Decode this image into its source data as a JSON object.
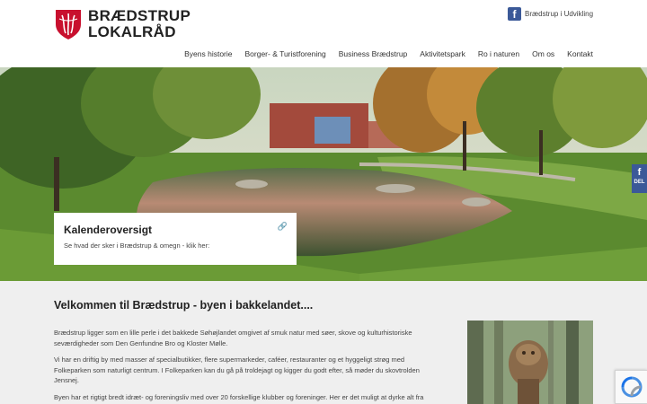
{
  "brand": {
    "line1": "BRÆDSTRUP",
    "line2": "LOKALRÅD"
  },
  "facebook": {
    "label": "Brædstrup i Udvikling",
    "icon": "facebook-icon",
    "color": "#3b5998"
  },
  "nav": [
    {
      "label": "Byens historie"
    },
    {
      "label": "Borger- & Turistforening"
    },
    {
      "label": "Business Brædstrup"
    },
    {
      "label": "Aktivitetspark"
    },
    {
      "label": "Ro i naturen"
    },
    {
      "label": "Om os"
    },
    {
      "label": "Kontakt"
    }
  ],
  "hero": {
    "card_title": "Kalenderoversigt",
    "card_subtitle": "Se hvad der sker i Brædstrup & omegn - klik her:",
    "link_icon": "link-icon"
  },
  "share": {
    "f": "f",
    "label": "DEL"
  },
  "content": {
    "heading": "Velkommen til Brædstrup - byen i bakkelandet....",
    "paragraphs": [
      "Brædstrup ligger som en lille perle i det bakkede Søhøjlandet omgivet af smuk natur med søer, skove og kulturhistoriske seværdigheder som Den Genfundne Bro og Kloster Mølle.",
      "Vi har en driftig by med masser af specialbutikker, flere supermarkeder, caféer, restauranter og et hyggeligt strøg med Folkeparken som naturligt centrum. I Folkeparken kan du gå på troldejagt og kigger du godt efter, så møder du skovtrolden Jensnej.",
      "Byen har et rigtigt bredt idræt- og foreningsliv med over 20 forskellige klubber og foreninger. Her er det muligt at dyrke alt fra fodbold, håndbold, svømning, ridning, karate, E-sport og mange andre idrætsgrene."
    ]
  },
  "colors": {
    "accent_red": "#c8102e",
    "facebook_blue": "#3b5998"
  }
}
